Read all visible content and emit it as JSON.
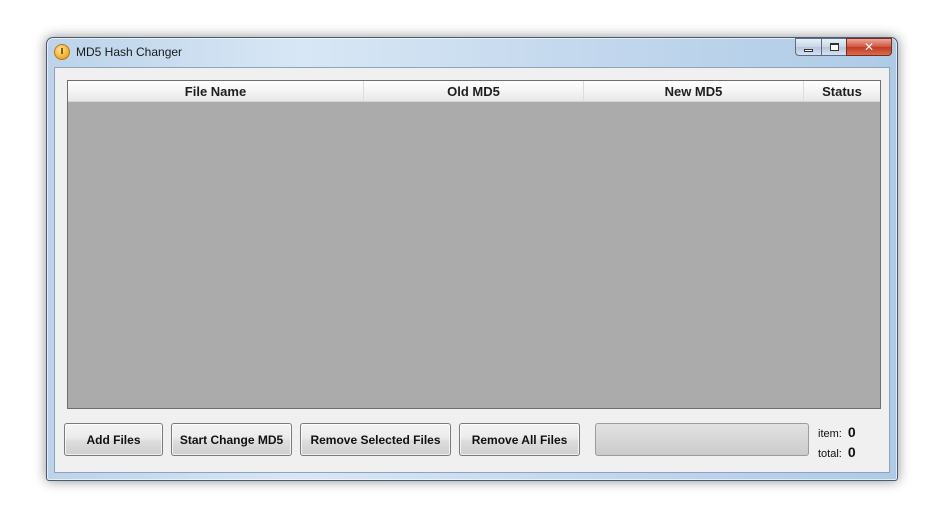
{
  "window": {
    "title": "MD5 Hash Changer",
    "icon": "md5-app-icon"
  },
  "window_controls": {
    "minimize_icon": "minimize-icon",
    "maximize_icon": "maximize-icon",
    "close_icon": "close-icon",
    "close_label": "✕"
  },
  "listview": {
    "columns": [
      "File Name",
      "Old MD5",
      "New MD5",
      "Status"
    ],
    "rows": []
  },
  "buttons": {
    "add_files": "Add Files",
    "start_change": "Start Change MD5",
    "remove_selected": "Remove Selected Files",
    "remove_all": "Remove All Files"
  },
  "progress": {
    "value": 0
  },
  "stats": {
    "item_label": "item:",
    "item_value": "0",
    "total_label": "total:",
    "total_value": "0"
  },
  "colors": {
    "list_background": "#ababab",
    "client_background": "#f0f0f0",
    "close_button": "#c23a22"
  }
}
